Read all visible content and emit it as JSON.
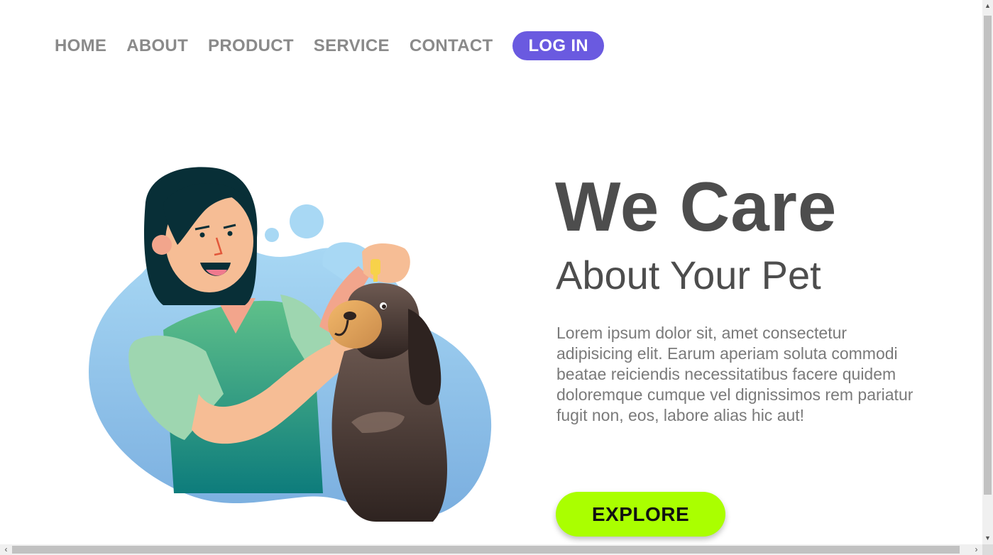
{
  "nav": {
    "items": [
      {
        "label": "HOME"
      },
      {
        "label": "ABOUT"
      },
      {
        "label": "PRODUCT"
      },
      {
        "label": "SERVICE"
      },
      {
        "label": "CONTACT"
      }
    ],
    "login_label": "LOG IN"
  },
  "hero": {
    "headline": "We Care",
    "subheadline": "About Your Pet",
    "body": "Lorem ipsum dolor sit, amet consectetur adipisicing elit. Earum aperiam soluta commodi beatae reiciendis necessitatibus facere quidem doloremque cumque vel dignissimos rem pariatur fugit non, eos, labore alias hic aut!",
    "cta_label": "EXPLORE"
  },
  "colors": {
    "accent": "#6a5ae0",
    "cta": "#aaff00",
    "text_dark": "#4d4d4d",
    "text_muted": "#8a8a8a"
  },
  "scrollbars": {
    "arrow_up": "▲",
    "arrow_down": "▼",
    "arrow_left": "‹",
    "arrow_right": "›"
  }
}
